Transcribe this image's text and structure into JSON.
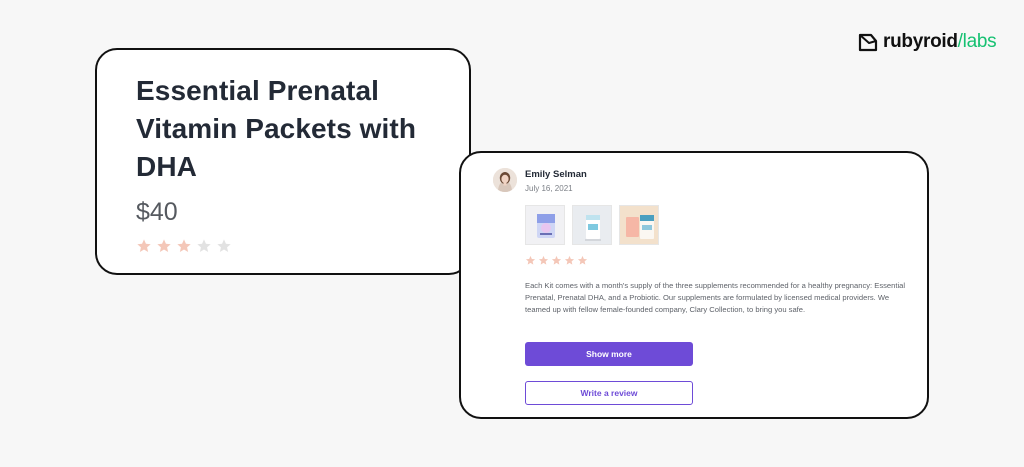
{
  "brand": {
    "name": "ruby",
    "name_mid": "roid",
    "accent": "/labs",
    "accent_color": "#16c172"
  },
  "product": {
    "title": "Essential Prenatal Vitamin Packets with DHA",
    "price": "$40",
    "rating": 3,
    "rating_max": 5
  },
  "review": {
    "reviewer_name": "Emily Selman",
    "date": "July 16, 2021",
    "rating": 5,
    "rating_max": 5,
    "images": [
      "product-photo-1",
      "product-photo-2",
      "product-photo-3"
    ],
    "text": "Each Kit comes with a month's supply of the three supplements recommended for a healthy pregnancy: Essential Prenatal, Prenatal DHA, and a Probiotic. Our supplements are formulated by licensed medical providers. We teamed up with fellow female-founded company, Clary Collection, to bring you safe.",
    "show_more_label": "Show more",
    "write_review_label": "Write a review"
  },
  "colors": {
    "star_filled": "#f4c7b8",
    "star_empty": "#e2e2e2",
    "primary": "#6e4bd7"
  }
}
